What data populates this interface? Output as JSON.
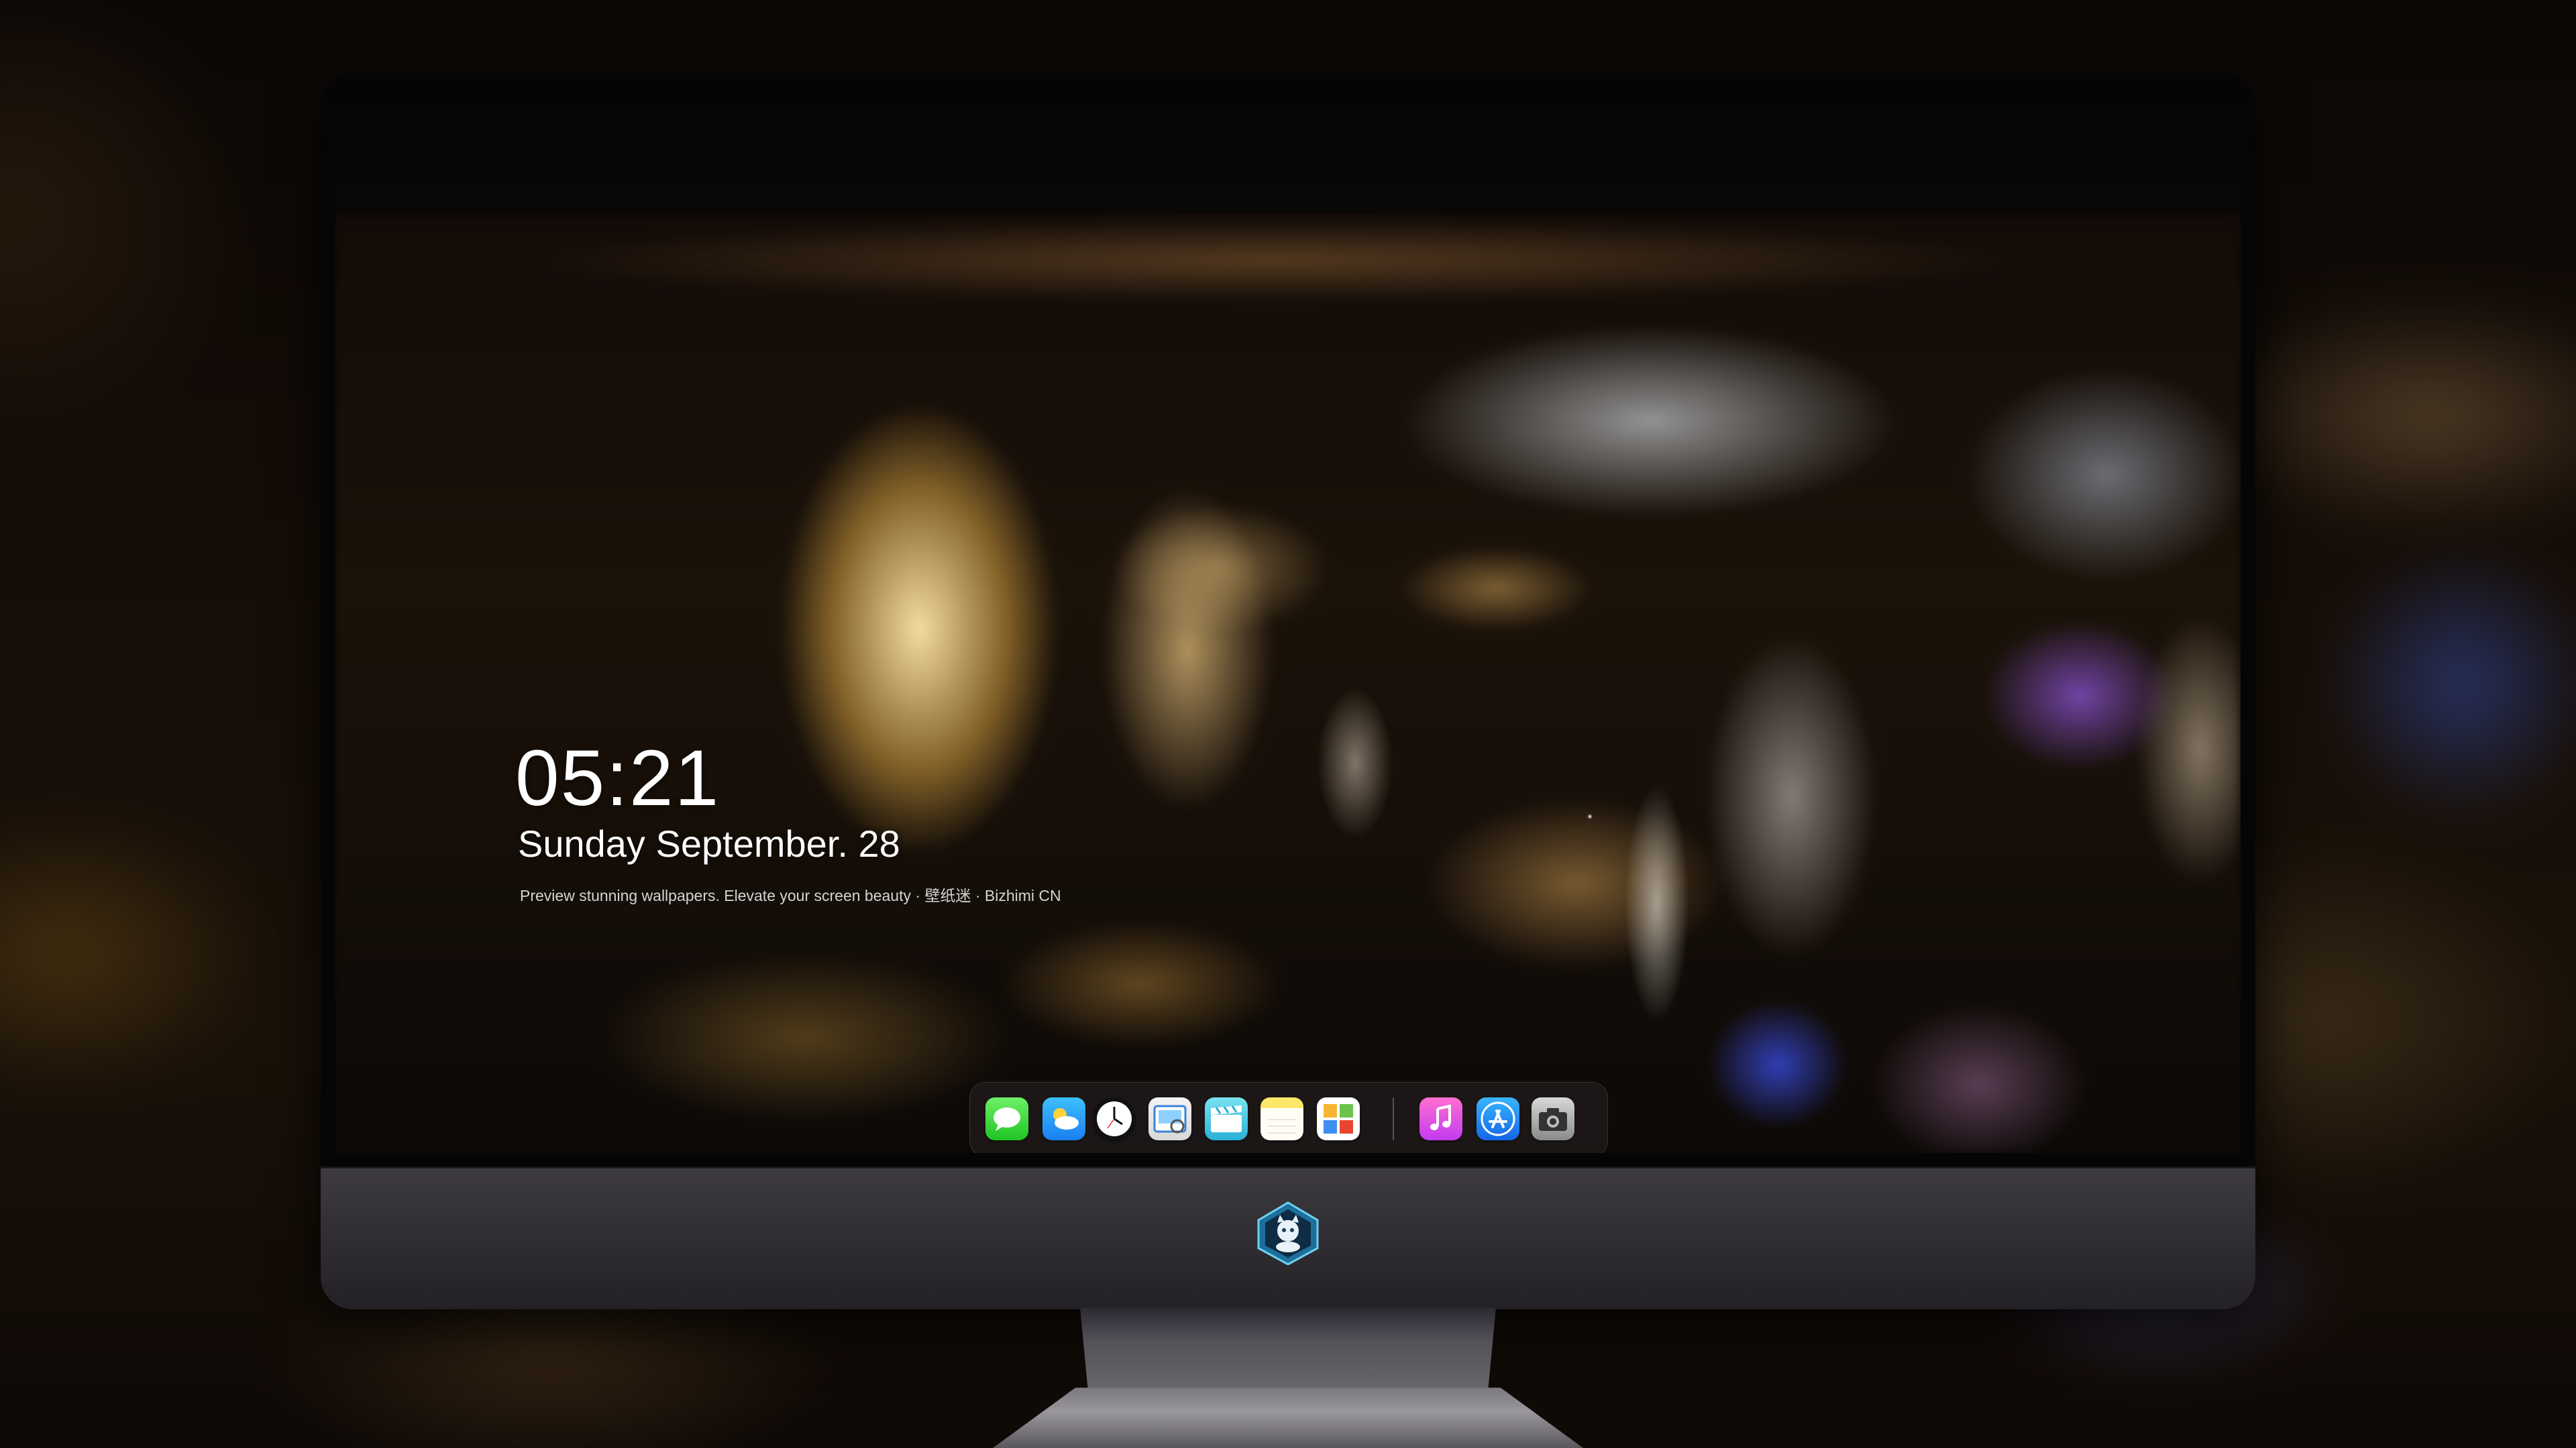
{
  "lockscreen": {
    "time": "05:21",
    "date": "Sunday September. 28",
    "caption": "Preview stunning wallpapers. Elevate your screen beauty · 壁纸迷 · Bizhimi CN"
  },
  "dock": {
    "apps": [
      {
        "name": "Messages",
        "icon": "messages-icon"
      },
      {
        "name": "Weather",
        "icon": "weather-icon"
      },
      {
        "name": "Clock",
        "icon": "clock-icon"
      },
      {
        "name": "Preview",
        "icon": "preview-icon"
      },
      {
        "name": "Clips",
        "icon": "clips-icon"
      },
      {
        "name": "Notes",
        "icon": "notes-icon"
      },
      {
        "name": "Photos",
        "icon": "photos-icon"
      },
      {
        "name": "Music",
        "icon": "music-icon"
      },
      {
        "name": "App Store",
        "icon": "app-store-icon"
      },
      {
        "name": "Camera",
        "icon": "camera-icon"
      }
    ]
  },
  "colors": {
    "text": "#ffffff",
    "bezel": "#050505",
    "chin": "#36333a"
  }
}
